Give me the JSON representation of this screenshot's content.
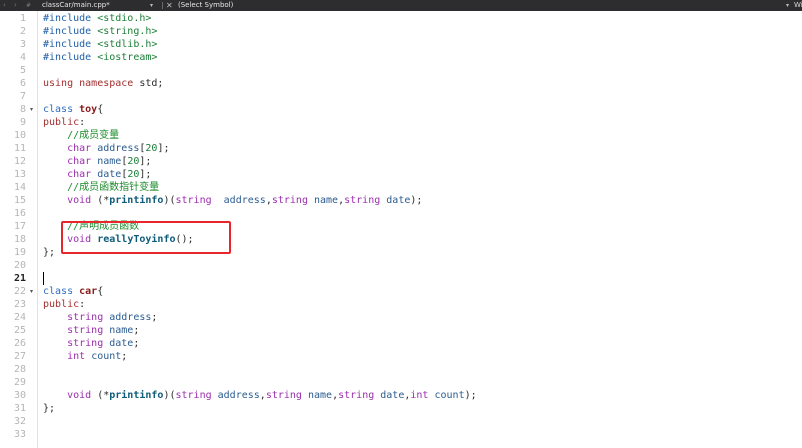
{
  "toolbar": {
    "back_icon": "‹",
    "forward_icon": "›",
    "hash_icon": "#",
    "file_tab": "classCar/main.cpp*",
    "dropdown_icon": "▾",
    "close_icon": "✕",
    "symbol_selector": "(Select Symbol)",
    "right_text": "Wi"
  },
  "editor": {
    "current_line": 21,
    "fold_marker": "▾",
    "line_numbers": [
      "1",
      "2",
      "3",
      "4",
      "5",
      "6",
      "7",
      "8",
      "9",
      "10",
      "11",
      "12",
      "13",
      "14",
      "15",
      "16",
      "17",
      "18",
      "19",
      "20",
      "21",
      "22",
      "23",
      "24",
      "25",
      "26",
      "27",
      "28",
      "29",
      "30",
      "31",
      "32",
      "33"
    ],
    "lines": {
      "l1": [
        "#include",
        " ",
        "<stdio.h>"
      ],
      "l2": [
        "#include",
        " ",
        "<string.h>"
      ],
      "l3": [
        "#include",
        " ",
        "<stdlib.h>"
      ],
      "l4": [
        "#include",
        " ",
        "<iostream>"
      ],
      "l6": [
        "using",
        " ",
        "namespace",
        " std;"
      ],
      "l8": [
        "class",
        " ",
        "toy",
        "{"
      ],
      "l9": [
        "public",
        ":"
      ],
      "l10": [
        "    ",
        "//成员变量"
      ],
      "l11": [
        "    ",
        "char",
        " ",
        "address",
        "[",
        "20",
        "];"
      ],
      "l12": [
        "    ",
        "char",
        " ",
        "name",
        "[",
        "20",
        "];"
      ],
      "l13": [
        "    ",
        "char",
        " ",
        "date",
        "[",
        "20",
        "];"
      ],
      "l14": [
        "    ",
        "//成员函数指针变量"
      ],
      "l15": [
        "    ",
        "void",
        " (*",
        "printinfo",
        ")(",
        "string",
        "  ",
        "address",
        ",",
        "string",
        " ",
        "name",
        ",",
        "string",
        " ",
        "date",
        ");"
      ],
      "l17": [
        "    ",
        "//声明成员函数"
      ],
      "l18": [
        "    ",
        "void",
        " ",
        "reallyToyinfo",
        "();"
      ],
      "l19": [
        "};"
      ],
      "l22": [
        "class",
        " ",
        "car",
        "{"
      ],
      "l23": [
        "public",
        ":"
      ],
      "l24": [
        "    ",
        "string",
        " ",
        "address",
        ";"
      ],
      "l25": [
        "    ",
        "string",
        " ",
        "name",
        ";"
      ],
      "l26": [
        "    ",
        "string",
        " ",
        "date",
        ";"
      ],
      "l27": [
        "    ",
        "int",
        " ",
        "count",
        ";"
      ],
      "l30": [
        "    ",
        "void",
        " (*",
        "printinfo",
        ")(",
        "string",
        " ",
        "address",
        ",",
        "string",
        " ",
        "name",
        ",",
        "string",
        " ",
        "date",
        ",",
        "int",
        " ",
        "count",
        ");"
      ],
      "l31": [
        "};"
      ]
    }
  },
  "colors": {
    "highlight_border": "#e8262b",
    "toolbar_bg": "#2d2d30"
  }
}
